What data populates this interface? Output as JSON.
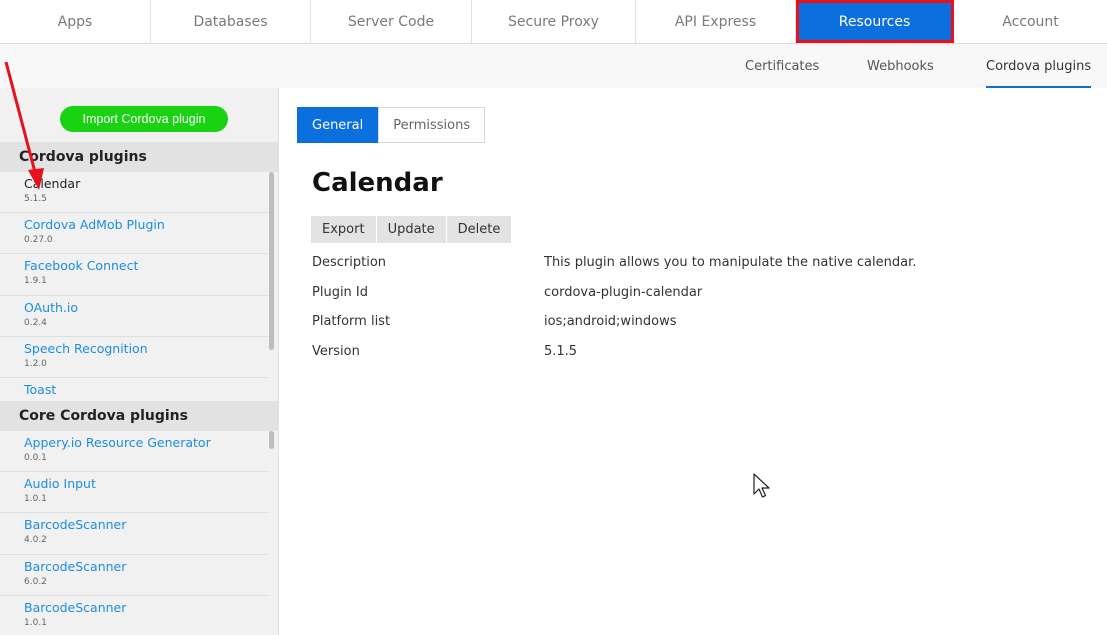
{
  "topnav": {
    "tabs": [
      {
        "label": "Apps"
      },
      {
        "label": "Databases"
      },
      {
        "label": "Server Code"
      },
      {
        "label": "Secure Proxy"
      },
      {
        "label": "API Express"
      },
      {
        "label": "Resources",
        "active": true
      },
      {
        "label": "Account"
      }
    ]
  },
  "subnav": {
    "items": [
      {
        "label": "Certificates"
      },
      {
        "label": "Webhooks"
      },
      {
        "label": "Cordova plugins",
        "active": true
      }
    ]
  },
  "sidebar": {
    "import_label": "Import Cordova plugin",
    "groups": [
      {
        "title": "Cordova plugins",
        "items": [
          {
            "name": "Calendar",
            "version": "5.1.5",
            "selected": true
          },
          {
            "name": "Cordova AdMob Plugin",
            "version": "0.27.0"
          },
          {
            "name": "Facebook Connect",
            "version": "1.9.1"
          },
          {
            "name": "OAuth.io",
            "version": "0.2.4"
          },
          {
            "name": "Speech Recognition",
            "version": "1.2.0"
          },
          {
            "name": "Toast",
            "version": ""
          }
        ]
      },
      {
        "title": "Core Cordova plugins",
        "items": [
          {
            "name": "Appery.io Resource Generator",
            "version": "0.0.1"
          },
          {
            "name": "Audio Input",
            "version": "1.0.1"
          },
          {
            "name": "BarcodeScanner",
            "version": "4.0.2"
          },
          {
            "name": "BarcodeScanner",
            "version": "6.0.2"
          },
          {
            "name": "BarcodeScanner",
            "version": "1.0.1"
          }
        ]
      }
    ]
  },
  "content": {
    "tabs": [
      {
        "label": "General",
        "active": true
      },
      {
        "label": "Permissions"
      }
    ],
    "title": "Calendar",
    "actions": [
      {
        "label": "Export"
      },
      {
        "label": "Update"
      },
      {
        "label": "Delete"
      }
    ],
    "properties": [
      {
        "key": "Description",
        "value": "This plugin allows you to manipulate the native calendar."
      },
      {
        "key": "Plugin Id",
        "value": "cordova-plugin-calendar"
      },
      {
        "key": "Platform list",
        "value": "ios;android;windows"
      },
      {
        "key": "Version",
        "value": "5.1.5"
      }
    ]
  },
  "colors": {
    "accent": "#0b6fde",
    "highlight": "#e8101a",
    "import_button": "#19d312",
    "link": "#1c8ddf"
  }
}
